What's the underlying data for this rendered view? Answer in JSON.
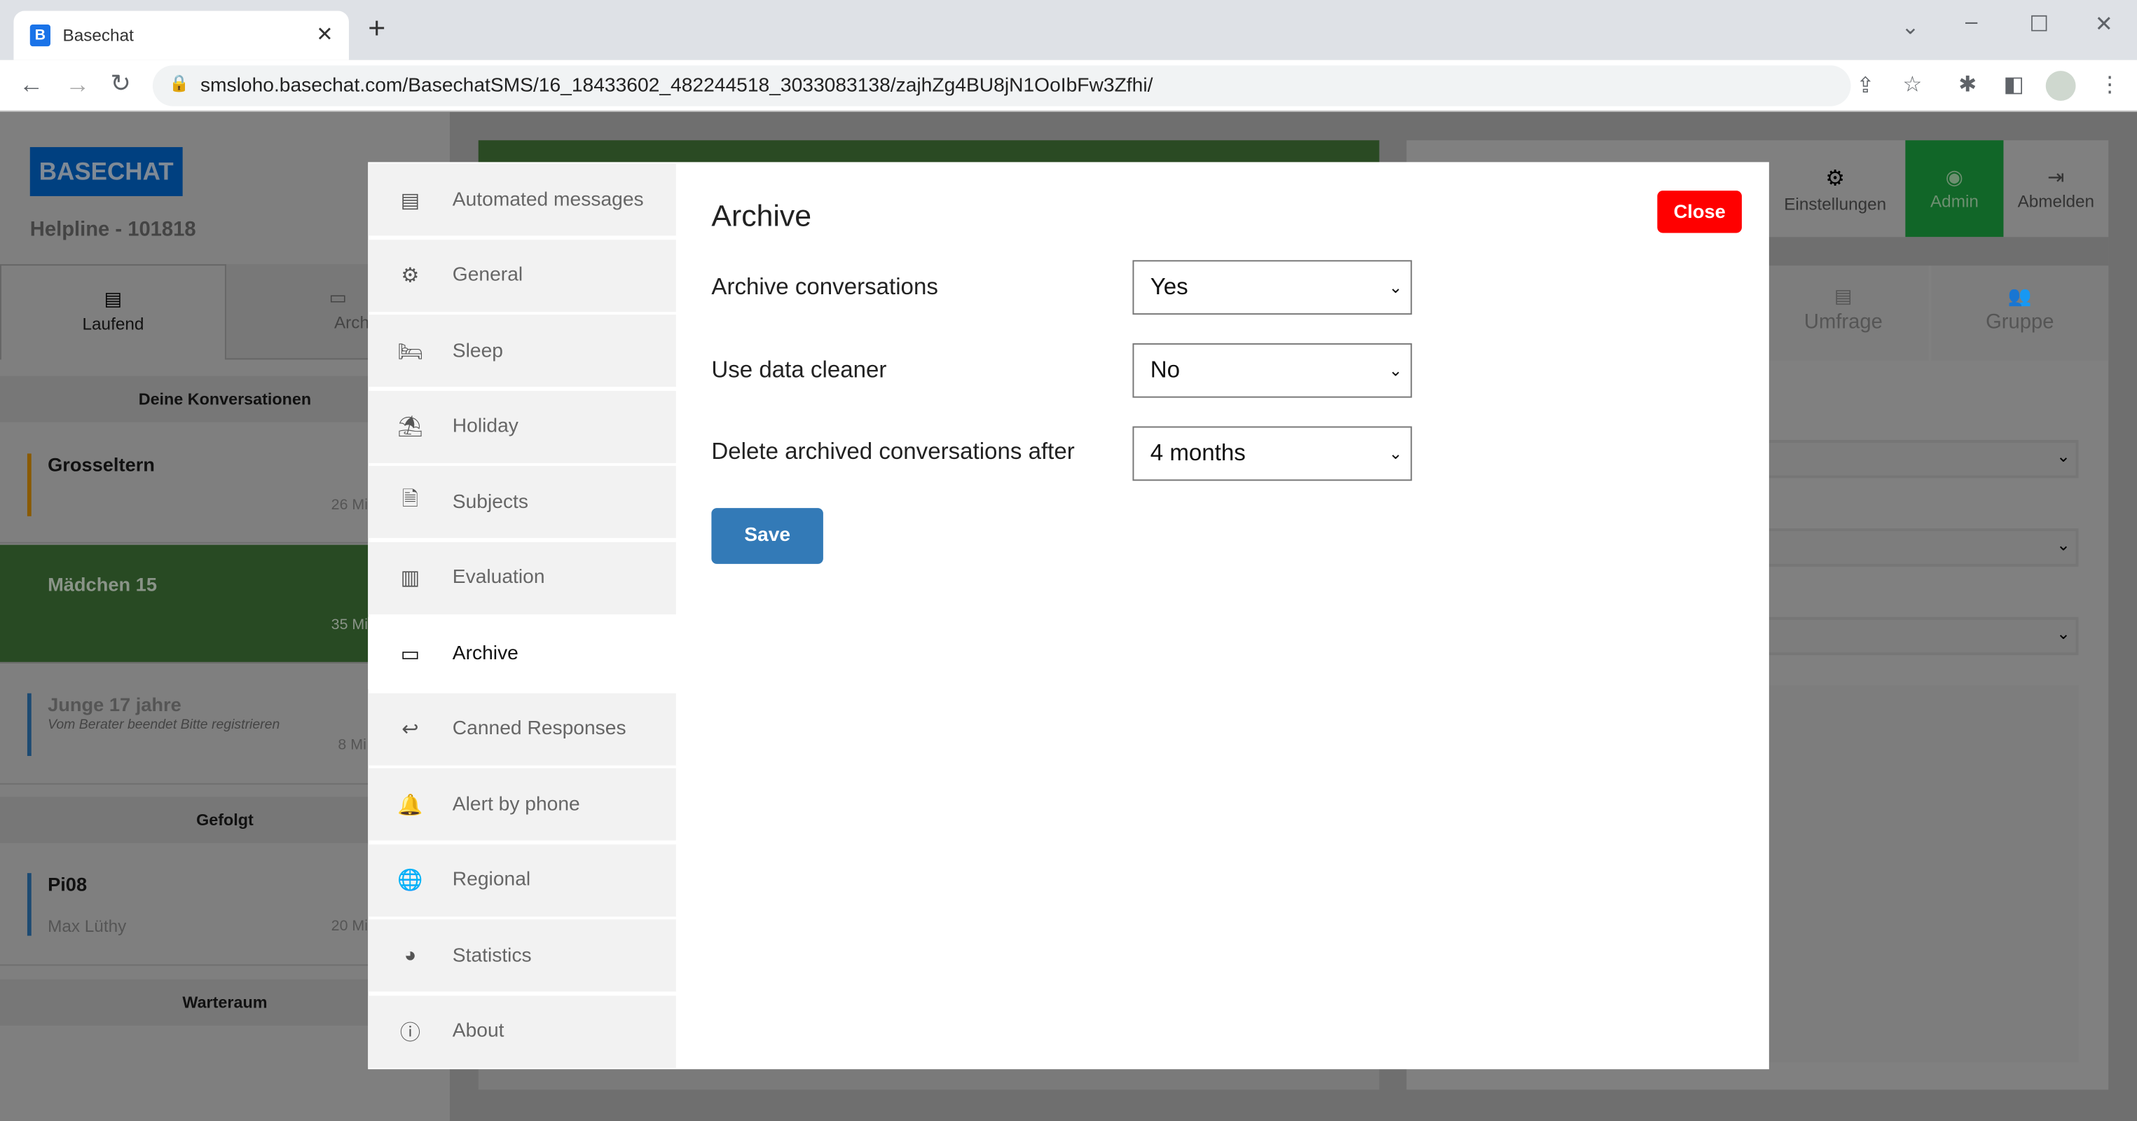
{
  "browser": {
    "tab_title": "Basechat",
    "favicon_letter": "B",
    "url": "smsloho.basechat.com/BasechatSMS/16_18433602_482244518_3033083138/zajhZg4BU8jN1OoIbFw3Zfhi/"
  },
  "sidebar": {
    "logo": "BASECHAT",
    "helpline": "Helpline - 101818",
    "tabs": [
      {
        "label": "Laufend"
      },
      {
        "label": "Archiviere"
      }
    ],
    "sections": {
      "mine": "Deine Konversationen",
      "followed": "Gefolgt",
      "waiting": "Warteraum"
    },
    "conversations": [
      {
        "name": "Grosseltern",
        "time": "26 Mi",
        "color": "#8a5a00"
      },
      {
        "name": "Mädchen 15",
        "time": "35 Mi"
      },
      {
        "name": "Junge 17 jahre",
        "sub": "Vom Berater beendet  Bitte registrieren",
        "time": "8 Mi",
        "color": "#1c4a72"
      },
      {
        "name": "Pi08",
        "sub": "Max Lüthy",
        "time": "20 Mi",
        "color": "#1c4a72"
      }
    ]
  },
  "right": {
    "buttons": [
      {
        "label": "Einstellungen"
      },
      {
        "label": "Admin"
      },
      {
        "label": "Abmelden"
      }
    ],
    "tabs": [
      {
        "label": "Umfrage"
      },
      {
        "label": "Gruppe"
      }
    ]
  },
  "modal": {
    "menu": [
      {
        "label": "Automated messages",
        "icon": "message-icon"
      },
      {
        "label": "General",
        "icon": "gear-icon"
      },
      {
        "label": "Sleep",
        "icon": "bed-icon"
      },
      {
        "label": "Holiday",
        "icon": "beach-icon"
      },
      {
        "label": "Subjects",
        "icon": "document-icon"
      },
      {
        "label": "Evaluation",
        "icon": "bar-chart-icon"
      },
      {
        "label": "Archive",
        "icon": "folder-icon"
      },
      {
        "label": "Canned Responses",
        "icon": "reply-icon"
      },
      {
        "label": "Alert by phone",
        "icon": "bell-icon"
      },
      {
        "label": "Regional",
        "icon": "globe-icon"
      },
      {
        "label": "Statistics",
        "icon": "pie-chart-icon"
      },
      {
        "label": "About",
        "icon": "info-icon"
      }
    ],
    "active": "Archive",
    "title": "Archive",
    "close_label": "Close",
    "fields": [
      {
        "label": "Archive conversations",
        "value": "Yes"
      },
      {
        "label": "Use data cleaner",
        "value": "No"
      },
      {
        "label": "Delete archived conversations after",
        "value": "4 months"
      }
    ],
    "save_label": "Save",
    "colors": {
      "close": "#ff0000",
      "save": "#337ab7",
      "admin": "#116628"
    }
  }
}
